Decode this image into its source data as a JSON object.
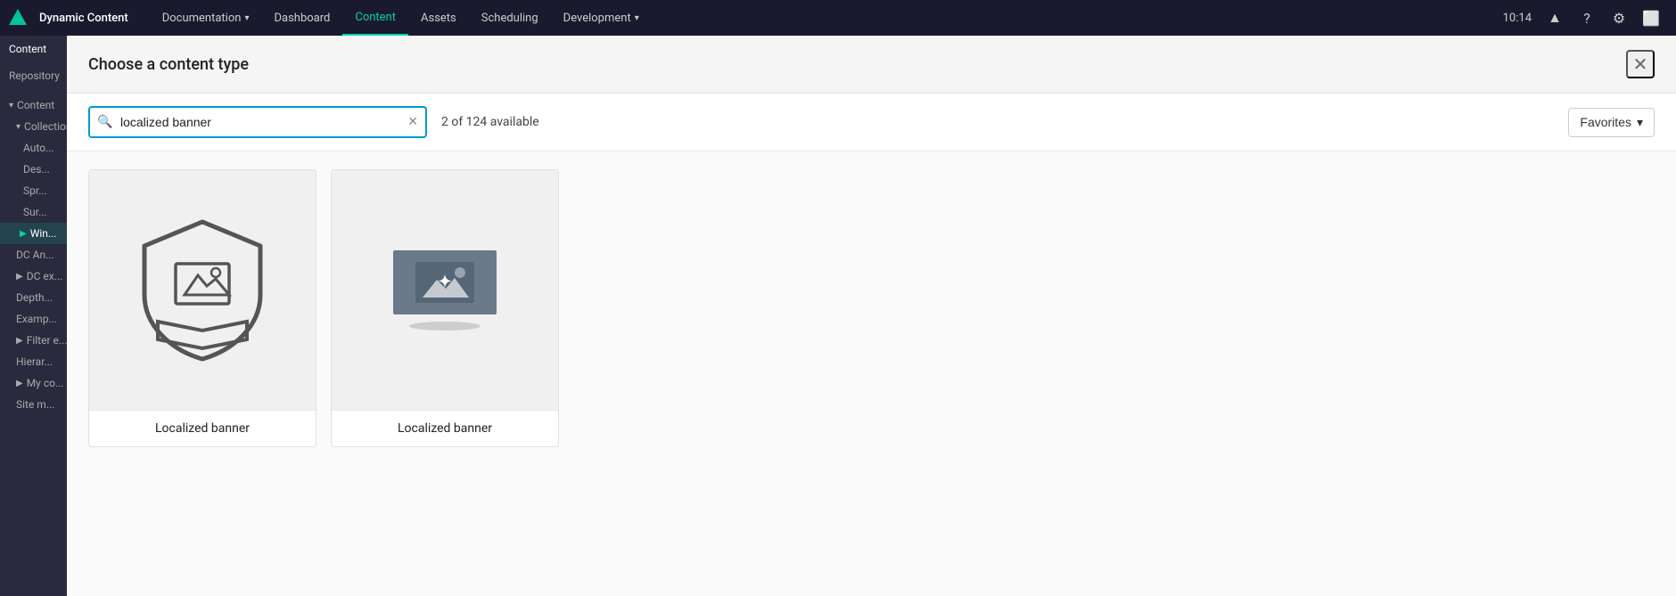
{
  "nav": {
    "app_name": "Dynamic Content",
    "items": [
      {
        "label": "Documentation",
        "has_chevron": true,
        "active": false
      },
      {
        "label": "Dashboard",
        "has_chevron": false,
        "active": false
      },
      {
        "label": "Content",
        "has_chevron": false,
        "active": true
      },
      {
        "label": "Assets",
        "has_chevron": false,
        "active": false
      },
      {
        "label": "Scheduling",
        "has_chevron": false,
        "active": false
      },
      {
        "label": "Development",
        "has_chevron": true,
        "active": false
      }
    ],
    "time": "10:14",
    "icons": [
      "help",
      "settings",
      "external-link"
    ]
  },
  "sidebar": {
    "top_tabs": [
      {
        "label": "Content",
        "active": true
      },
      {
        "label": "Repository",
        "active": false
      }
    ],
    "sections": [
      {
        "items": [
          {
            "label": "Content",
            "indent": 0,
            "expandable": true,
            "expanded": true,
            "active": false
          },
          {
            "label": "Collections",
            "indent": 1,
            "expandable": true,
            "expanded": true,
            "active": false
          },
          {
            "label": "Auto...",
            "indent": 2,
            "expandable": false,
            "active": false
          },
          {
            "label": "Des...",
            "indent": 2,
            "expandable": false,
            "active": false
          },
          {
            "label": "Spr...",
            "indent": 2,
            "expandable": false,
            "active": false
          },
          {
            "label": "Sur...",
            "indent": 2,
            "expandable": false,
            "active": false
          },
          {
            "label": "Win...",
            "indent": 2,
            "expandable": false,
            "active": true
          },
          {
            "label": "DC An...",
            "indent": 1,
            "expandable": false,
            "active": false
          },
          {
            "label": "DC ex...",
            "indent": 1,
            "expandable": true,
            "expanded": false,
            "active": false
          },
          {
            "label": "Depth...",
            "indent": 1,
            "expandable": false,
            "active": false
          },
          {
            "label": "Examp...",
            "indent": 1,
            "expandable": false,
            "active": false
          },
          {
            "label": "Filter e...",
            "indent": 1,
            "expandable": true,
            "expanded": false,
            "active": false
          },
          {
            "label": "Hierar...",
            "indent": 1,
            "expandable": false,
            "active": false
          },
          {
            "label": "My co...",
            "indent": 1,
            "expandable": true,
            "expanded": false,
            "active": false
          },
          {
            "label": "Site m...",
            "indent": 1,
            "expandable": false,
            "active": false
          }
        ]
      }
    ]
  },
  "modal": {
    "title": "Choose a content type",
    "search_placeholder": "localized banner",
    "search_value": "localized banner",
    "results_text": "2 of 124 available",
    "favorites_label": "Favorites",
    "cards": [
      {
        "label": "Localized banner",
        "type": "shield"
      },
      {
        "label": "Localized banner",
        "type": "photo"
      }
    ]
  }
}
